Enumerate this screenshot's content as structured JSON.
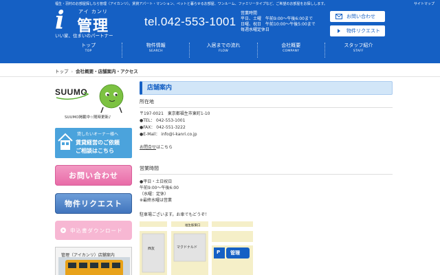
{
  "header": {
    "tagline_top": "福生・羽村のお部屋探しなら管理（アイカンリ）。賃貸アパート・マンション、ペットと暮らせるお部屋、ワンルーム、ファミリータイプなど、ご希望のお部屋をお探しします。",
    "sitemap": "サイトマップ",
    "logo_i": "i",
    "logo_ruby": "アイ カンリ",
    "logo_name": "管理",
    "logo_slogan": "いい家、住まいのパートナー",
    "tel": "tel.042-553-1001",
    "hours": [
      "営業時間",
      "平日、土曜　午前9:00〜午後6:00まで",
      "日曜、祝日　午前10:00〜午後5:00まで",
      "毎週水曜定休日"
    ],
    "contact_button": "お問い合わせ",
    "request_button": "物件リクエスト"
  },
  "nav": [
    {
      "jp": "トップ",
      "en": "TOP"
    },
    {
      "jp": "物件情報",
      "en": "SEARCH"
    },
    {
      "jp": "入居までの流れ",
      "en": "FLOW"
    },
    {
      "jp": "会社概要",
      "en": "COMPANY"
    },
    {
      "jp": "スタッフ紹介",
      "en": "STAFF"
    }
  ],
  "breadcrumb": {
    "home": "トップ",
    "current": "会社概要・店舗案内・アクセス"
  },
  "sidebar": {
    "suumo_logo": "SUUMO",
    "suumo_caption": "SUUMO掲載中☆随時更新♪",
    "owner_line1": "貸したいオーナー様へ",
    "owner_line2": "賃貸経営のご依頼",
    "owner_line3": "ご相談はこちら",
    "contact_button": "お問い合わせ",
    "request_button": "物件リクエスト",
    "download_button": "申込書ダウンロード",
    "store_caption": "管理（アイカンリ）店舗案内"
  },
  "main": {
    "section_title": "店舗案内",
    "address_heading": "所在地",
    "address_lines": [
      "〒197-0021　東京都福生市東町1-10",
      "●TEL：  042-553-1001",
      "●FAX：  042-551-3222",
      "●E-Mail：  info@i-kanri.co.jp"
    ],
    "inquiry_link": "お問合せ",
    "inquiry_suffix": "はこちら",
    "hours_heading": "営業時間",
    "hours_lines": [
      "●平日・土日祝日",
      "午前9:00〜午後6:00",
      "（水曜：定休）",
      "※最終水曜は営業"
    ],
    "parking_note": "駐車場ございます。お車でもどうぞ！",
    "map_labels": {
      "station": "福生駅東口",
      "shop1": "マクドナルド",
      "shop2": "西友",
      "brand": "管理"
    }
  },
  "colors": {
    "brand_blue": "#1560c4",
    "pink": "#e86aa7",
    "light_blue": "#4ba3dc"
  }
}
